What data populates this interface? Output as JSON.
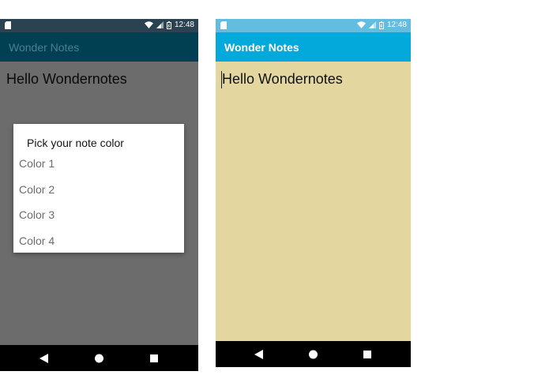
{
  "status_bar": {
    "time": "12:48"
  },
  "left_screen": {
    "app_title": "Wonder Notes",
    "note_text": "Hello Wondernotes",
    "dialog": {
      "title": "Pick your note color",
      "options": [
        "Color 1",
        "Color 2",
        "Color 3",
        "Color 4"
      ]
    }
  },
  "right_screen": {
    "app_title": "Wonder Notes",
    "note_text": "Hello Wondernotes"
  },
  "icons": {
    "send": "paper-plane-icon",
    "palette": "color-wheel-icon",
    "back": "back-triangle-icon",
    "home": "home-circle-icon",
    "recents": "recents-square-icon"
  },
  "colors": {
    "note_background": "#e3d79f",
    "app_bar": "#04a9dc",
    "status_bar": "#62bde0",
    "send_button": "#26a4de"
  }
}
